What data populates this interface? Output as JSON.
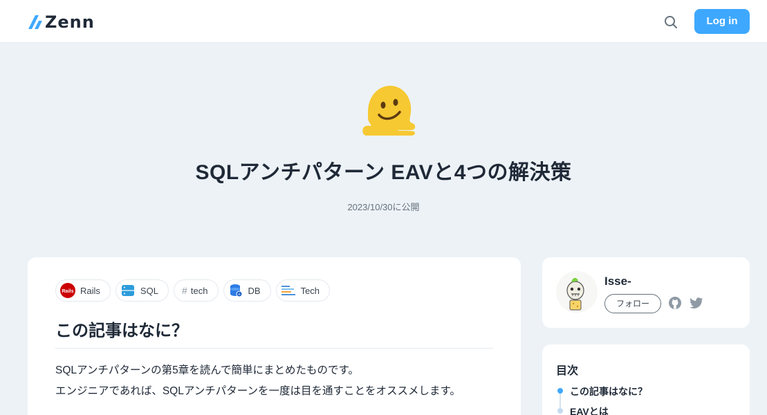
{
  "header": {
    "logo_text": "Zenn",
    "login_label": "Log in",
    "search_icon": "search-icon"
  },
  "article": {
    "title": "SQLアンチパターン EAVと4つの解決策",
    "published": "2023/10/30に公開",
    "tags": [
      {
        "label": "Rails",
        "icon": "rails-icon"
      },
      {
        "label": "SQL",
        "icon": "sql-icon"
      },
      {
        "label": "tech",
        "icon": "hash-icon"
      },
      {
        "label": "DB",
        "icon": "database-icon"
      },
      {
        "label": "Tech",
        "icon": "tech-icon"
      }
    ],
    "section_heading": "この記事はなに？",
    "paragraphs": [
      "SQLアンチパターンの第5章を読んで簡単にまとめたものです。",
      "エンジニアであれば、SQLアンチパターンを一度は目を通すことをオススメします。"
    ]
  },
  "author": {
    "name": "Isse-",
    "follow_label": "フォロー"
  },
  "toc": {
    "title": "目次",
    "items": [
      "この記事はなに？",
      "EAVとは"
    ]
  },
  "colors": {
    "accent": "#3ea8ff",
    "background": "#edf2f7",
    "card": "#ffffff",
    "text": "#1f2937",
    "muted": "#65717b"
  }
}
